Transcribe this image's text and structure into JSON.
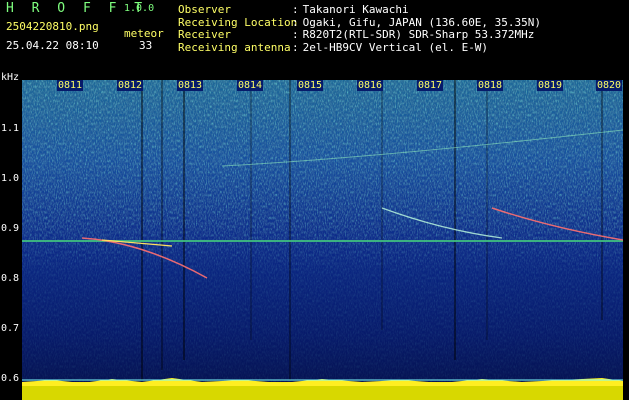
{
  "header": {
    "app_name": "H R O F F T",
    "version": "1.0.0",
    "filename": "2504220810.png",
    "datetime": "25.04.22 08:10",
    "meteor_label": "meteor",
    "meteor_count": "33"
  },
  "info": [
    {
      "label": "Observer",
      "value": "Takanori Kawachi"
    },
    {
      "label": "Receiving Location",
      "value": "Ogaki, Gifu, JAPAN (136.60E, 35.35N)"
    },
    {
      "label": "Receiver",
      "value": "R820T2(RTL-SDR) SDR-Sharp 53.372MHz"
    },
    {
      "label": "Receiving antenna",
      "value": "2el-HB9CV Vertical (el. E-W)"
    }
  ],
  "axis": {
    "y_unit": "kHz",
    "y_ticks": [
      "1.1",
      "1.0",
      "0.9",
      "0.8",
      "0.7",
      "0.6"
    ],
    "x_ticks": [
      "0811",
      "0812",
      "0813",
      "0814",
      "0815",
      "0816",
      "0817",
      "0818",
      "0819",
      "0820"
    ]
  },
  "colors": {
    "background": "#000000",
    "title_green": "#7fff7f",
    "label_yellow": "#ffff66",
    "noise_deep": "#061a6a",
    "noise_bright": "#3fbf7f",
    "signal_line": "#ff6060",
    "baseline_yellow": "#ffee22"
  }
}
